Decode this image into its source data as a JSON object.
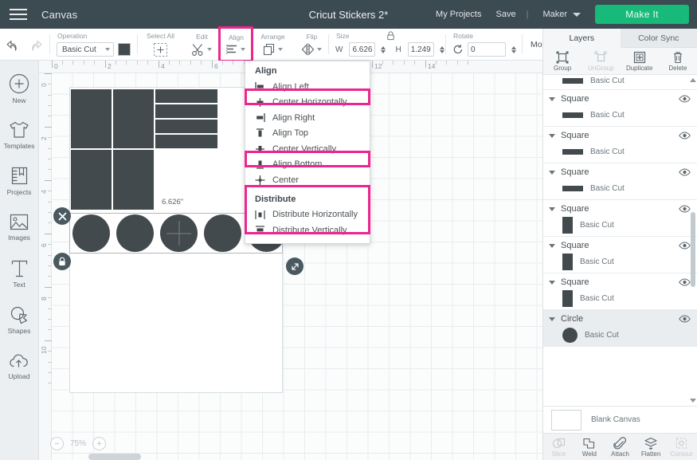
{
  "header": {
    "menu_icon": "hamburger-icon",
    "canvas_label": "Canvas",
    "project_title": "Cricut Stickers 2*",
    "my_projects": "My Projects",
    "save": "Save",
    "separator": "|",
    "machine": "Maker",
    "make_it": "Make It",
    "accent_green": "#17ba78",
    "bg": "#3c4a52"
  },
  "toolbar": {
    "undo_icon": "undo-icon",
    "redo_icon": "redo-icon",
    "operation": {
      "label": "Operation",
      "value": "Basic Cut",
      "swatch_color": "#434a4e"
    },
    "select_all": {
      "label": "Select All",
      "icon": "select-all-icon"
    },
    "edit": {
      "label": "Edit",
      "icon": "scissors-icon"
    },
    "align": {
      "label": "Align",
      "icon": "align-icon",
      "highlighted": true,
      "highlight_color": "#ec268f"
    },
    "arrange": {
      "label": "Arrange",
      "icon": "arrange-icon"
    },
    "flip": {
      "label": "Flip",
      "icon": "flip-icon"
    },
    "size": {
      "label": "Size",
      "w_label": "W",
      "w_value": "6.626",
      "h_label": "H",
      "h_value": "1.249",
      "lock_icon": "lock-icon"
    },
    "rotate": {
      "label": "Rotate",
      "icon": "rotate-icon",
      "value": "0"
    },
    "more": "More"
  },
  "left_rail": {
    "items": [
      {
        "label": "New",
        "icon": "plus-circle-icon"
      },
      {
        "label": "Templates",
        "icon": "tshirt-icon"
      },
      {
        "label": "Projects",
        "icon": "book-icon"
      },
      {
        "label": "Images",
        "icon": "picture-icon"
      },
      {
        "label": "Text",
        "icon": "text-icon"
      },
      {
        "label": "Shapes",
        "icon": "shapes-icon"
      },
      {
        "label": "Upload",
        "icon": "upload-cloud-icon"
      }
    ]
  },
  "canvas": {
    "ruler_h_ticks": [
      "0",
      "2",
      "4",
      "6",
      "8",
      "10",
      "12",
      "14"
    ],
    "ruler_v_ticks": [
      "0",
      "2",
      "4",
      "6",
      "8",
      "10"
    ],
    "dimension_label": "6.626\"",
    "zoom_level": "75%",
    "zoom_out_icon": "minus-circle-icon",
    "zoom_in_icon": "plus-circle-icon",
    "selection": {
      "delete_icon": "close-x-icon",
      "lock_icon": "lock-icon",
      "resize_icon": "resize-diagonal-icon",
      "rotate_center_icon": "crosshair-icon"
    },
    "shape_fill": "#434a4e"
  },
  "align_menu": {
    "align_header": "Align",
    "align_items": [
      {
        "label": "Align Left",
        "icon": "align-left-icon",
        "highlighted": false
      },
      {
        "label": "Center Horizontally",
        "icon": "center-horizontal-icon",
        "highlighted": true
      },
      {
        "label": "Align Right",
        "icon": "align-right-icon",
        "highlighted": false
      },
      {
        "label": "Align Top",
        "icon": "align-top-icon",
        "highlighted": false
      },
      {
        "label": "Center Vertically",
        "icon": "center-vertical-icon",
        "highlighted": false
      },
      {
        "label": "Align Bottom",
        "icon": "align-bottom-icon",
        "highlighted": true
      },
      {
        "label": "Center",
        "icon": "center-icon",
        "highlighted": false
      }
    ],
    "distribute_header": "Distribute",
    "distribute_items": [
      {
        "label": "Distribute Horizontally",
        "icon": "distribute-horizontal-icon"
      },
      {
        "label": "Distribute Vertically",
        "icon": "distribute-vertical-icon"
      }
    ],
    "highlight_color": "#ec268f"
  },
  "right_panel": {
    "tabs": [
      {
        "label": "Layers",
        "active": true
      },
      {
        "label": "Color Sync",
        "active": false
      }
    ],
    "actions": [
      {
        "label": "Group",
        "icon": "group-icon",
        "disabled": false
      },
      {
        "label": "UnGroup",
        "icon": "ungroup-icon",
        "disabled": true
      },
      {
        "label": "Duplicate",
        "icon": "duplicate-icon",
        "disabled": false
      },
      {
        "label": "Delete",
        "icon": "trash-icon",
        "disabled": false
      }
    ],
    "layers": [
      {
        "name": "",
        "sub": "Basic Cut",
        "thumb": "bar",
        "partial": true,
        "selected": false
      },
      {
        "name": "Square",
        "sub": "Basic Cut",
        "thumb": "bar",
        "selected": false
      },
      {
        "name": "Square",
        "sub": "Basic Cut",
        "thumb": "bar",
        "selected": false
      },
      {
        "name": "Square",
        "sub": "Basic Cut",
        "thumb": "bar",
        "selected": false
      },
      {
        "name": "Square",
        "sub": "Basic Cut",
        "thumb": "square",
        "selected": false
      },
      {
        "name": "Square",
        "sub": "Basic Cut",
        "thumb": "square",
        "selected": false
      },
      {
        "name": "Square",
        "sub": "Basic Cut",
        "thumb": "square",
        "selected": false
      },
      {
        "name": "Circle",
        "sub": "Basic Cut",
        "thumb": "circle",
        "selected": true
      }
    ],
    "eye_icon": "eye-icon",
    "blank_canvas": {
      "label": "Blank Canvas",
      "icon": "blank-canvas-thumb"
    },
    "ops": [
      {
        "label": "Slice",
        "icon": "slice-icon",
        "disabled": true
      },
      {
        "label": "Weld",
        "icon": "weld-icon",
        "disabled": false
      },
      {
        "label": "Attach",
        "icon": "attach-paperclip-icon",
        "disabled": false
      },
      {
        "label": "Flatten",
        "icon": "flatten-icon",
        "disabled": false
      },
      {
        "label": "Contour",
        "icon": "contour-icon",
        "disabled": true
      }
    ]
  }
}
